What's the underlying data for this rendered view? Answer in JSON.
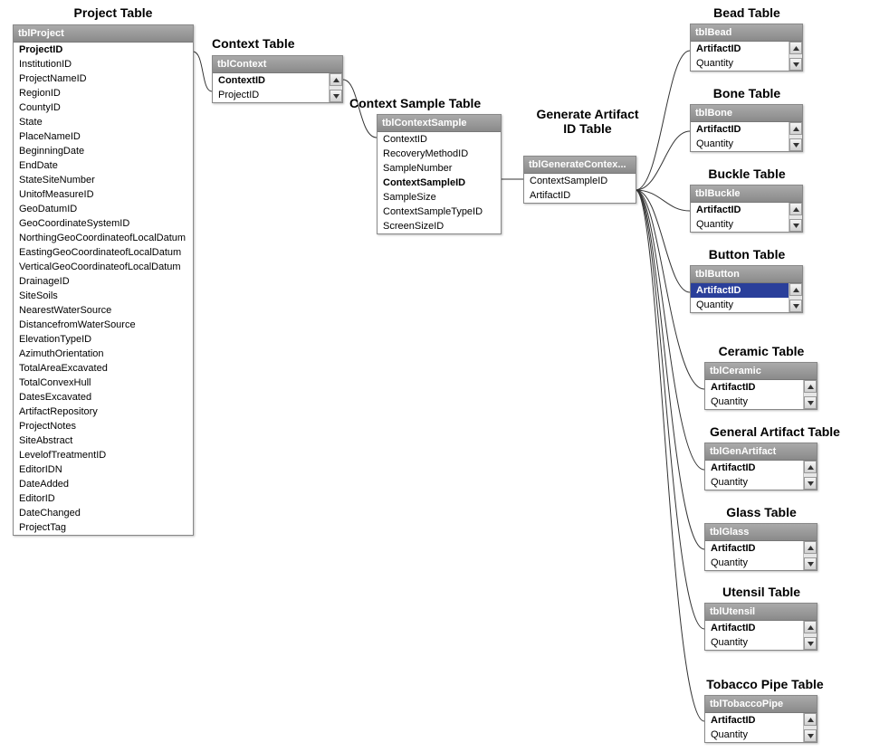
{
  "labels": {
    "project": "Project Table",
    "context": "Context Table",
    "contextSample": "Context Sample Table",
    "generate": "Generate Artifact ID Table",
    "bead": "Bead Table",
    "bone": "Bone Table",
    "buckle": "Buckle Table",
    "button": "Button Table",
    "ceramic": "Ceramic Table",
    "genart": "General Artifact Table",
    "glass": "Glass Table",
    "utensil": "Utensil Table",
    "pipe": "Tobacco Pipe Table"
  },
  "tables": {
    "project": {
      "header": "tblProject",
      "scroll": false,
      "rows": [
        {
          "t": "ProjectID",
          "b": true
        },
        {
          "t": "InstitutionID"
        },
        {
          "t": "ProjectNameID"
        },
        {
          "t": "RegionID"
        },
        {
          "t": "CountyID"
        },
        {
          "t": "State"
        },
        {
          "t": "PlaceNameID"
        },
        {
          "t": "BeginningDate"
        },
        {
          "t": "EndDate"
        },
        {
          "t": "StateSiteNumber"
        },
        {
          "t": "UnitofMeasureID"
        },
        {
          "t": "GeoDatumID"
        },
        {
          "t": "GeoCoordinateSystemID"
        },
        {
          "t": "NorthingGeoCoordinateofLocalDatum"
        },
        {
          "t": "EastingGeoCoordinateofLocalDatum"
        },
        {
          "t": "VerticalGeoCoordinateofLocalDatum"
        },
        {
          "t": "DrainageID"
        },
        {
          "t": "SiteSoils"
        },
        {
          "t": "NearestWaterSource"
        },
        {
          "t": "DistancefromWaterSource"
        },
        {
          "t": "ElevationTypeID"
        },
        {
          "t": "AzimuthOrientation"
        },
        {
          "t": "TotalAreaExcavated"
        },
        {
          "t": "TotalConvexHull"
        },
        {
          "t": "DatesExcavated"
        },
        {
          "t": "ArtifactRepository"
        },
        {
          "t": "ProjectNotes"
        },
        {
          "t": "SiteAbstract"
        },
        {
          "t": "LevelofTreatmentID"
        },
        {
          "t": "EditorIDN"
        },
        {
          "t": "DateAdded"
        },
        {
          "t": "EditorID"
        },
        {
          "t": "DateChanged"
        },
        {
          "t": "ProjectTag"
        }
      ]
    },
    "context": {
      "header": "tblContext",
      "scroll": true,
      "rows": [
        {
          "t": "ContextID",
          "b": true
        },
        {
          "t": "ProjectID"
        }
      ]
    },
    "contextSample": {
      "header": "tblContextSample",
      "scroll": false,
      "rows": [
        {
          "t": "ContextID"
        },
        {
          "t": "RecoveryMethodID"
        },
        {
          "t": "SampleNumber"
        },
        {
          "t": "ContextSampleID",
          "b": true
        },
        {
          "t": "SampleSize"
        },
        {
          "t": "ContextSampleTypeID"
        },
        {
          "t": "ScreenSizeID"
        }
      ]
    },
    "generate": {
      "header": "tblGenerateContex...",
      "scroll": false,
      "rows": [
        {
          "t": "ContextSampleID"
        },
        {
          "t": "ArtifactID"
        }
      ]
    },
    "bead": {
      "header": "tblBead",
      "scroll": true,
      "rows": [
        {
          "t": "ArtifactID",
          "b": true
        },
        {
          "t": "Quantity"
        }
      ]
    },
    "bone": {
      "header": "tblBone",
      "scroll": true,
      "rows": [
        {
          "t": "ArtifactID",
          "b": true
        },
        {
          "t": "Quantity"
        }
      ]
    },
    "buckle": {
      "header": "tblBuckle",
      "scroll": true,
      "rows": [
        {
          "t": "ArtifactID",
          "b": true
        },
        {
          "t": "Quantity"
        }
      ]
    },
    "button": {
      "header": "tblButton",
      "scroll": true,
      "rows": [
        {
          "t": "ArtifactID",
          "b": true,
          "hl": true
        },
        {
          "t": "Quantity"
        }
      ]
    },
    "ceramic": {
      "header": "tblCeramic",
      "scroll": true,
      "rows": [
        {
          "t": "ArtifactID",
          "b": true
        },
        {
          "t": "Quantity"
        }
      ]
    },
    "genart": {
      "header": "tblGenArtifact",
      "scroll": true,
      "rows": [
        {
          "t": "ArtifactID",
          "b": true
        },
        {
          "t": "Quantity"
        }
      ]
    },
    "glass": {
      "header": "tblGlass",
      "scroll": true,
      "rows": [
        {
          "t": "ArtifactID",
          "b": true
        },
        {
          "t": "Quantity"
        }
      ]
    },
    "utensil": {
      "header": "tblUtensil",
      "scroll": true,
      "rows": [
        {
          "t": "ArtifactID",
          "b": true
        },
        {
          "t": "Quantity"
        }
      ]
    },
    "pipe": {
      "header": "tblTobaccoPipe",
      "scroll": true,
      "rows": [
        {
          "t": "ArtifactID",
          "b": true
        },
        {
          "t": "Quantity"
        }
      ]
    }
  }
}
